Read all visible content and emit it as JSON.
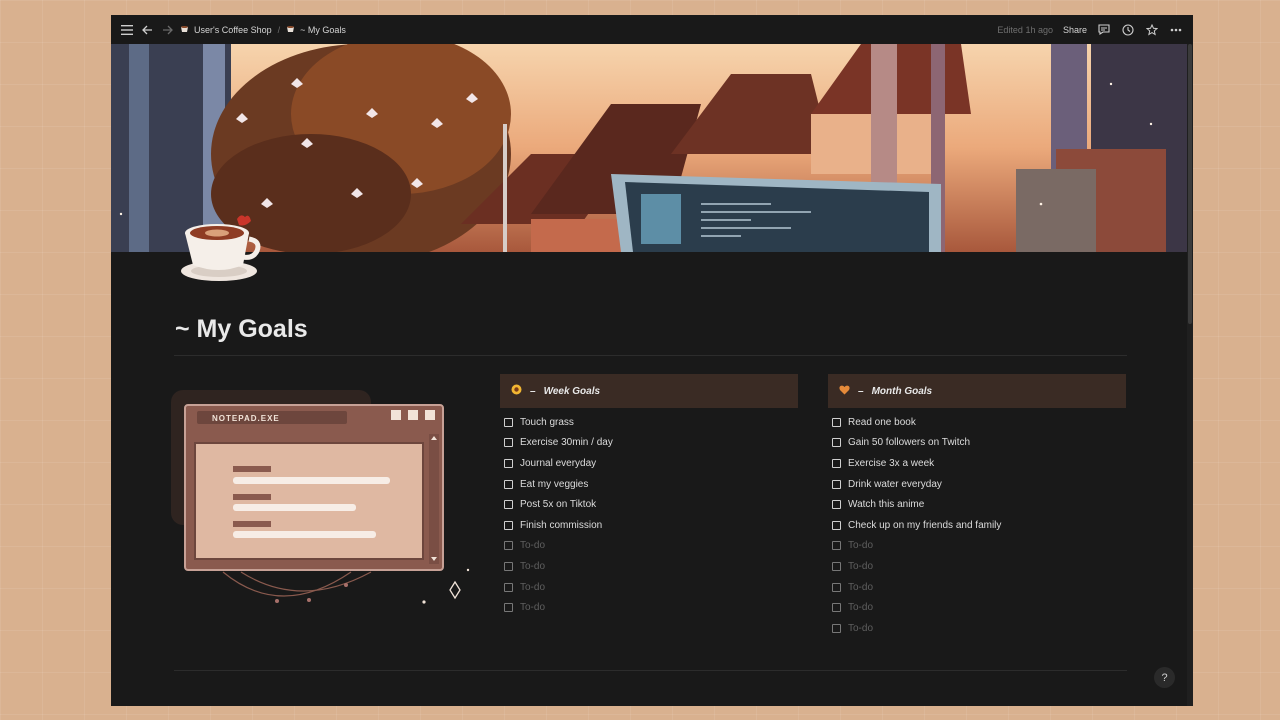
{
  "topbar": {
    "breadcrumb": [
      {
        "label": "User's Coffee Shop"
      },
      {
        "label": "~ My Goals"
      }
    ],
    "separator": "/",
    "edited": "Edited 1h ago",
    "share_label": "Share"
  },
  "page": {
    "title": "~ My Goals"
  },
  "notepad": {
    "title": "NOTEPAD.EXE"
  },
  "columns": [
    {
      "dash": "–",
      "heading": "Week Goals",
      "icon": "sunflower-icon",
      "items": [
        "Touch grass",
        "Exercise 30min / day",
        "Journal everyday",
        "Eat my veggies",
        "Post 5x on Tiktok",
        "Finish commission"
      ],
      "placeholders": [
        "To-do",
        "To-do",
        "To-do",
        "To-do"
      ]
    },
    {
      "dash": "–",
      "heading": "Month Goals",
      "icon": "orange-heart-icon",
      "items": [
        "Read one book",
        "Gain 50 followers on Twitch",
        "Exercise 3x a week",
        "Drink water everyday",
        "Watch this anime",
        "Check up on my friends and family"
      ],
      "placeholders": [
        "To-do",
        "To-do",
        "To-do",
        "To-do",
        "To-do"
      ]
    }
  ],
  "help_label": "?",
  "colors": {
    "background": "#191919",
    "column_header": "#3a2b24",
    "text": "#e9e9e9",
    "placeholder": "#5f5f5f",
    "accent": "#e58a3a"
  }
}
